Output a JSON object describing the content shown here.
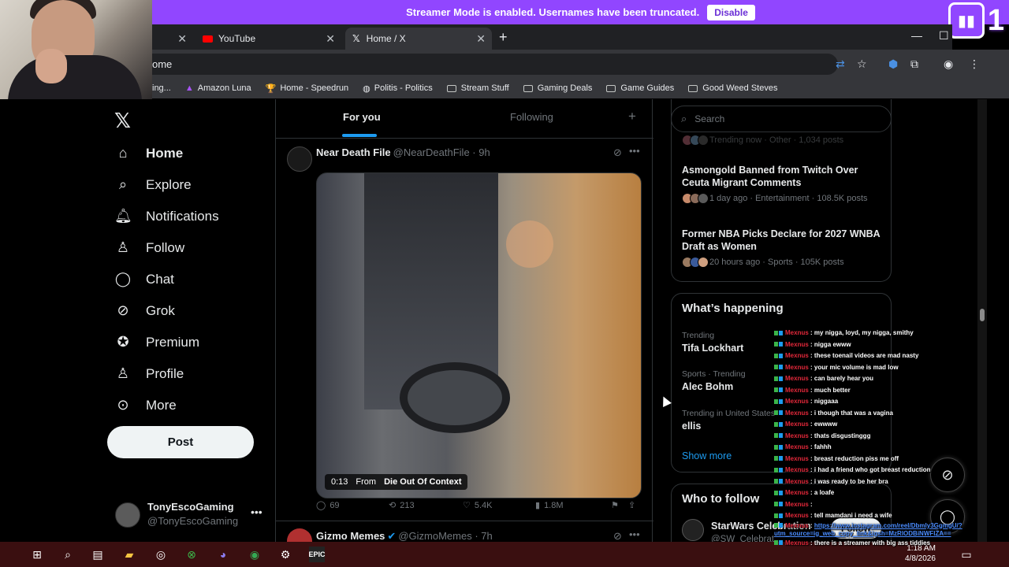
{
  "banner": {
    "text": "Streamer Mode is enabled. Usernames have been truncated.",
    "button": "Disable"
  },
  "twitch": {
    "number": "1"
  },
  "browser": {
    "tabs": [
      {
        "label": "YouTube"
      },
      {
        "label": "Home / X"
      }
    ],
    "address": "ome",
    "bookmarks": [
      "ing...",
      "Amazon Luna",
      "Home - Speedrun",
      "Politis - Politics",
      "Stream Stuff",
      "Gaming Deals",
      "Game Guides",
      "Good Weed Steves"
    ]
  },
  "nav": {
    "items": [
      "Home",
      "Explore",
      "Notifications",
      "Follow",
      "Chat",
      "Grok",
      "Premium",
      "Profile",
      "More"
    ],
    "post": "Post",
    "account": {
      "name": "TonyEscoGaming",
      "handle": "@TonyEscoGaming"
    }
  },
  "feed": {
    "tabs": [
      "For you",
      "Following"
    ],
    "tweet1": {
      "name": "Near Death File",
      "handle": "@NearDeathFile · 9h",
      "media_time": "0:13",
      "media_from": "From",
      "media_source": "Die Out Of Context",
      "replies": "69",
      "reposts": "213",
      "likes": "5.4K",
      "views": "1.8M"
    },
    "tweet2": {
      "name": "Gizmo Memes",
      "handle": "@GizmoMemes · 7h"
    }
  },
  "sidebar": {
    "search_placeholder": "Search",
    "news_top_meta": "Trending now · Other · 1,034 posts",
    "news": [
      {
        "title": "Asmongold Banned from Twitch Over Ceuta Migrant Comments",
        "meta": "1 day ago · Entertainment · 108.5K posts"
      },
      {
        "title": "Former NBA Picks Declare for 2027 WNBA Draft as Women",
        "meta": "20 hours ago · Sports · 105K posts"
      }
    ],
    "whats_happening": "What’s happening",
    "trends": [
      {
        "cat": "Trending",
        "topic": "Tifa Lockhart"
      },
      {
        "cat": "Sports · Trending",
        "topic": "Alec Bohm"
      },
      {
        "cat": "Trending in United States",
        "topic": "ellis"
      }
    ],
    "show_more": "Show more",
    "who_to_follow": "Who to follow",
    "follow_suggestion": {
      "name": "StarWars Celebration",
      "handle": "@SW_Celebrat",
      "button": "Follow"
    }
  },
  "chat": {
    "user": "Mexnus",
    "messages": [
      "my nigga, loyd, my nigga, smithy",
      "nigga ewww",
      "these toenail videos are mad nasty",
      "your mic volume is mad low",
      "can barely hear you",
      "much better",
      "niggaaa",
      "i though that was a vagina",
      "ewwww",
      "thats disgustinggg",
      "fahhh",
      "breast reduction piss me off",
      "i had a friend who got breast reduction",
      "i was ready to be her bra",
      "a loafe",
      "",
      "tell mamdani i need a wife",
      "https://www.instagram.com/reel/Dbmly3GgmgU/?utm_source=ig_web_copy_link&igsh=MzRlODBiNWFlZA==",
      "there is a streamer with big ass tiddies"
    ]
  },
  "taskbar": {
    "time": "1:18 AM",
    "date": "4/8/2026"
  }
}
